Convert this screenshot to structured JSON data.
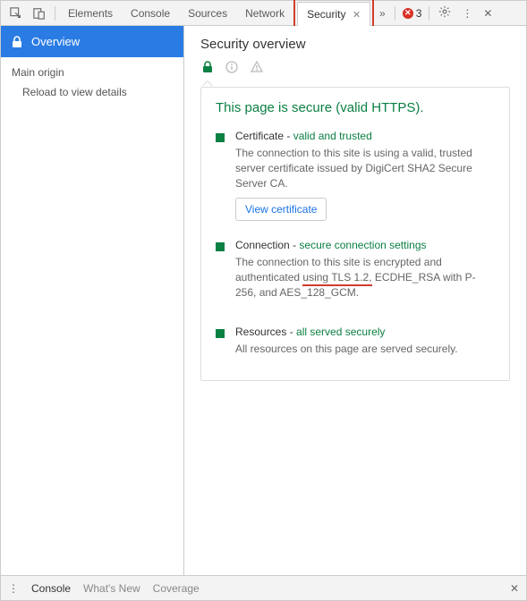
{
  "topbar": {
    "tabs": {
      "elements": "Elements",
      "console": "Console",
      "sources": "Sources",
      "network": "Network",
      "security": "Security"
    },
    "error_count": "3"
  },
  "sidebar": {
    "overview": "Overview",
    "main_origin": "Main origin",
    "reload_msg": "Reload to view details"
  },
  "content": {
    "heading": "Security overview",
    "secure_line": "This page is secure (valid HTTPS).",
    "cert": {
      "label": "Certificate",
      "status": "valid and trusted",
      "desc": "The connection to this site is using a valid, trusted server certificate issued by DigiCert SHA2 Secure Server CA.",
      "button": "View certificate"
    },
    "conn": {
      "label": "Connection",
      "status": "secure connection settings",
      "desc_pre": "The connection to this site is encrypted and authenticated ",
      "desc_underlined": "using TLS 1.2,",
      "desc_post": " ECDHE_RSA with P-256, and AES_128_GCM."
    },
    "res": {
      "label": "Resources",
      "status": "all served securely",
      "desc": "All resources on this page are served securely."
    }
  },
  "drawer": {
    "console": "Console",
    "whatsnew": "What's New",
    "coverage": "Coverage"
  }
}
